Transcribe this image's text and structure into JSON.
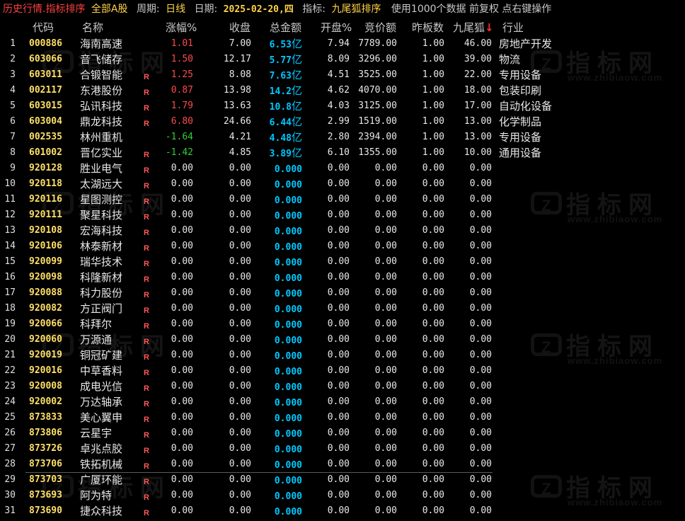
{
  "toolbar": {
    "mode": "历史行情.指标排序",
    "market": "全部A股",
    "period_label": "周期:",
    "period_value": "日线",
    "date_label": "日期:",
    "date_value": "2025-02-20,四",
    "indicator_label": "指标:",
    "indicator_value": "九尾狐排序",
    "info": "使用1000个数据 前复权 点右键操作"
  },
  "columns": {
    "code": "代码",
    "name": "名称",
    "change": "涨幅",
    "change_unit": "%",
    "close": "收盘",
    "amount": "总金额",
    "open": "开盘",
    "open_unit": "%",
    "bid": "竞价额",
    "prev_limit": "昨板数",
    "nine_tail": "九尾狐",
    "sort_arrow": "↓",
    "industry": "行业"
  },
  "watermark": {
    "badge": "Z",
    "text": "指标网",
    "subtitle": "www.zhibiaow.com"
  },
  "rows": [
    {
      "idx": "1",
      "code": "000886",
      "name": "海南高速",
      "r": "",
      "chg": "1.01",
      "dir": "up",
      "close": "7.00",
      "amt": "6.53",
      "unit": "亿",
      "open": "7.94",
      "bid": "7789.00",
      "prev": "1.00",
      "nine": "46.00",
      "ind": "房地产开发"
    },
    {
      "idx": "2",
      "code": "603066",
      "name": "音飞储存",
      "r": "",
      "chg": "1.50",
      "dir": "up",
      "close": "12.17",
      "amt": "5.77",
      "unit": "亿",
      "open": "8.09",
      "bid": "3296.00",
      "prev": "1.00",
      "nine": "39.00",
      "ind": "物流"
    },
    {
      "idx": "3",
      "code": "603011",
      "name": "合锻智能",
      "r": "R",
      "chg": "1.25",
      "dir": "up",
      "close": "8.08",
      "amt": "7.63",
      "unit": "亿",
      "open": "4.51",
      "bid": "3525.00",
      "prev": "1.00",
      "nine": "22.00",
      "ind": "专用设备"
    },
    {
      "idx": "4",
      "code": "002117",
      "name": "东港股份",
      "r": "R",
      "chg": "0.87",
      "dir": "up",
      "close": "13.98",
      "amt": "14.2",
      "unit": "亿",
      "open": "4.62",
      "bid": "4070.00",
      "prev": "1.00",
      "nine": "18.00",
      "ind": "包装印刷"
    },
    {
      "idx": "5",
      "code": "603015",
      "name": "弘讯科技",
      "r": "R",
      "chg": "1.79",
      "dir": "up",
      "close": "13.63",
      "amt": "10.8",
      "unit": "亿",
      "open": "4.03",
      "bid": "3125.00",
      "prev": "1.00",
      "nine": "17.00",
      "ind": "自动化设备"
    },
    {
      "idx": "6",
      "code": "603004",
      "name": "鼎龙科技",
      "r": "R",
      "chg": "6.80",
      "dir": "up",
      "close": "24.66",
      "amt": "6.44",
      "unit": "亿",
      "open": "2.99",
      "bid": "1519.00",
      "prev": "1.00",
      "nine": "13.00",
      "ind": "化学制品"
    },
    {
      "idx": "7",
      "code": "002535",
      "name": "林州重机",
      "r": "",
      "chg": "-1.64",
      "dir": "down",
      "close": "4.21",
      "amt": "4.48",
      "unit": "亿",
      "open": "2.80",
      "bid": "2394.00",
      "prev": "1.00",
      "nine": "13.00",
      "ind": "专用设备"
    },
    {
      "idx": "8",
      "code": "601002",
      "name": "晋亿实业",
      "r": "R",
      "chg": "-1.42",
      "dir": "down",
      "close": "4.85",
      "amt": "3.89",
      "unit": "亿",
      "open": "6.10",
      "bid": "1355.00",
      "prev": "1.00",
      "nine": "10.00",
      "ind": "通用设备"
    },
    {
      "idx": "9",
      "code": "920128",
      "name": "胜业电气",
      "r": "R",
      "chg": "0.00",
      "dir": "flat",
      "close": "0.00",
      "amt": "0.000",
      "unit": "",
      "open": "0.00",
      "bid": "0.00",
      "prev": "0.00",
      "nine": "0.00",
      "ind": ""
    },
    {
      "idx": "10",
      "code": "920118",
      "name": "太湖远大",
      "r": "R",
      "chg": "0.00",
      "dir": "flat",
      "close": "0.00",
      "amt": "0.000",
      "unit": "",
      "open": "0.00",
      "bid": "0.00",
      "prev": "0.00",
      "nine": "0.00",
      "ind": ""
    },
    {
      "idx": "11",
      "code": "920116",
      "name": "星图测控",
      "r": "R",
      "chg": "0.00",
      "dir": "flat",
      "close": "0.00",
      "amt": "0.000",
      "unit": "",
      "open": "0.00",
      "bid": "0.00",
      "prev": "0.00",
      "nine": "0.00",
      "ind": ""
    },
    {
      "idx": "12",
      "code": "920111",
      "name": "聚星科技",
      "r": "R",
      "chg": "0.00",
      "dir": "flat",
      "close": "0.00",
      "amt": "0.000",
      "unit": "",
      "open": "0.00",
      "bid": "0.00",
      "prev": "0.00",
      "nine": "0.00",
      "ind": ""
    },
    {
      "idx": "13",
      "code": "920108",
      "name": "宏海科技",
      "r": "R",
      "chg": "0.00",
      "dir": "flat",
      "close": "0.00",
      "amt": "0.000",
      "unit": "",
      "open": "0.00",
      "bid": "0.00",
      "prev": "0.00",
      "nine": "0.00",
      "ind": ""
    },
    {
      "idx": "14",
      "code": "920106",
      "name": "林泰新材",
      "r": "R",
      "chg": "0.00",
      "dir": "flat",
      "close": "0.00",
      "amt": "0.000",
      "unit": "",
      "open": "0.00",
      "bid": "0.00",
      "prev": "0.00",
      "nine": "0.00",
      "ind": ""
    },
    {
      "idx": "15",
      "code": "920099",
      "name": "瑞华技术",
      "r": "R",
      "chg": "0.00",
      "dir": "flat",
      "close": "0.00",
      "amt": "0.000",
      "unit": "",
      "open": "0.00",
      "bid": "0.00",
      "prev": "0.00",
      "nine": "0.00",
      "ind": ""
    },
    {
      "idx": "16",
      "code": "920098",
      "name": "科隆新材",
      "r": "R",
      "chg": "0.00",
      "dir": "flat",
      "close": "0.00",
      "amt": "0.000",
      "unit": "",
      "open": "0.00",
      "bid": "0.00",
      "prev": "0.00",
      "nine": "0.00",
      "ind": ""
    },
    {
      "idx": "17",
      "code": "920088",
      "name": "科力股份",
      "r": "R",
      "chg": "0.00",
      "dir": "flat",
      "close": "0.00",
      "amt": "0.000",
      "unit": "",
      "open": "0.00",
      "bid": "0.00",
      "prev": "0.00",
      "nine": "0.00",
      "ind": ""
    },
    {
      "idx": "18",
      "code": "920082",
      "name": "方正阀门",
      "r": "R",
      "chg": "0.00",
      "dir": "flat",
      "close": "0.00",
      "amt": "0.000",
      "unit": "",
      "open": "0.00",
      "bid": "0.00",
      "prev": "0.00",
      "nine": "0.00",
      "ind": ""
    },
    {
      "idx": "19",
      "code": "920066",
      "name": "科拜尔",
      "r": "R",
      "chg": "0.00",
      "dir": "flat",
      "close": "0.00",
      "amt": "0.000",
      "unit": "",
      "open": "0.00",
      "bid": "0.00",
      "prev": "0.00",
      "nine": "0.00",
      "ind": ""
    },
    {
      "idx": "20",
      "code": "920060",
      "name": "万源通",
      "r": "R",
      "chg": "0.00",
      "dir": "flat",
      "close": "0.00",
      "amt": "0.000",
      "unit": "",
      "open": "0.00",
      "bid": "0.00",
      "prev": "0.00",
      "nine": "0.00",
      "ind": ""
    },
    {
      "idx": "21",
      "code": "920019",
      "name": "铜冠矿建",
      "r": "R",
      "chg": "0.00",
      "dir": "flat",
      "close": "0.00",
      "amt": "0.000",
      "unit": "",
      "open": "0.00",
      "bid": "0.00",
      "prev": "0.00",
      "nine": "0.00",
      "ind": ""
    },
    {
      "idx": "22",
      "code": "920016",
      "name": "中草香料",
      "r": "R",
      "chg": "0.00",
      "dir": "flat",
      "close": "0.00",
      "amt": "0.000",
      "unit": "",
      "open": "0.00",
      "bid": "0.00",
      "prev": "0.00",
      "nine": "0.00",
      "ind": ""
    },
    {
      "idx": "23",
      "code": "920008",
      "name": "成电光信",
      "r": "R",
      "chg": "0.00",
      "dir": "flat",
      "close": "0.00",
      "amt": "0.000",
      "unit": "",
      "open": "0.00",
      "bid": "0.00",
      "prev": "0.00",
      "nine": "0.00",
      "ind": ""
    },
    {
      "idx": "24",
      "code": "920002",
      "name": "万达轴承",
      "r": "R",
      "chg": "0.00",
      "dir": "flat",
      "close": "0.00",
      "amt": "0.000",
      "unit": "",
      "open": "0.00",
      "bid": "0.00",
      "prev": "0.00",
      "nine": "0.00",
      "ind": ""
    },
    {
      "idx": "25",
      "code": "873833",
      "name": "美心翼申",
      "r": "R",
      "chg": "0.00",
      "dir": "flat",
      "close": "0.00",
      "amt": "0.000",
      "unit": "",
      "open": "0.00",
      "bid": "0.00",
      "prev": "0.00",
      "nine": "0.00",
      "ind": ""
    },
    {
      "idx": "26",
      "code": "873806",
      "name": "云星宇",
      "r": "R",
      "chg": "0.00",
      "dir": "flat",
      "close": "0.00",
      "amt": "0.000",
      "unit": "",
      "open": "0.00",
      "bid": "0.00",
      "prev": "0.00",
      "nine": "0.00",
      "ind": ""
    },
    {
      "idx": "27",
      "code": "873726",
      "name": "卓兆点胶",
      "r": "R",
      "chg": "0.00",
      "dir": "flat",
      "close": "0.00",
      "amt": "0.000",
      "unit": "",
      "open": "0.00",
      "bid": "0.00",
      "prev": "0.00",
      "nine": "0.00",
      "ind": ""
    },
    {
      "idx": "28",
      "code": "873706",
      "name": "铁拓机械",
      "r": "R",
      "chg": "0.00",
      "dir": "flat",
      "close": "0.00",
      "amt": "0.000",
      "unit": "",
      "open": "0.00",
      "bid": "0.00",
      "prev": "0.00",
      "nine": "0.00",
      "ind": ""
    },
    {
      "idx": "29",
      "code": "873703",
      "name": "广厦环能",
      "r": "R",
      "chg": "0.00",
      "dir": "flat",
      "close": "0.00",
      "amt": "0.000",
      "unit": "",
      "open": "0.00",
      "bid": "0.00",
      "prev": "0.00",
      "nine": "0.00",
      "ind": ""
    },
    {
      "idx": "30",
      "code": "873693",
      "name": "阿为特",
      "r": "R",
      "chg": "0.00",
      "dir": "flat",
      "close": "0.00",
      "amt": "0.000",
      "unit": "",
      "open": "0.00",
      "bid": "0.00",
      "prev": "0.00",
      "nine": "0.00",
      "ind": ""
    },
    {
      "idx": "31",
      "code": "873690",
      "name": "捷众科技",
      "r": "R",
      "chg": "0.00",
      "dir": "flat",
      "close": "0.00",
      "amt": "0.000",
      "unit": "",
      "open": "0.00",
      "bid": "0.00",
      "prev": "0.00",
      "nine": "0.00",
      "ind": ""
    }
  ]
}
